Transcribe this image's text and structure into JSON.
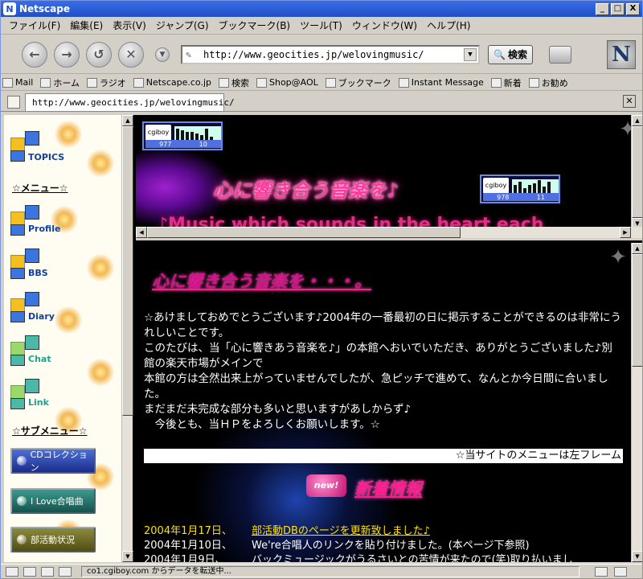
{
  "window": {
    "title": "Netscape",
    "buttons": [
      "_",
      "□",
      "X"
    ]
  },
  "menu": [
    "ファイル(F)",
    "編集(E)",
    "表示(V)",
    "ジャンプ(G)",
    "ブックマーク(B)",
    "ツール(T)",
    "ウィンドウ(W)",
    "ヘルプ(H)"
  ],
  "nav": {
    "url": "http://www.geocities.jp/welovingmusic/",
    "search_label": "検索",
    "logo_letter": "N"
  },
  "personal_toolbar": [
    "Mail",
    "ホーム",
    "ラジオ",
    "Netscape.co.jp",
    "検索",
    "Shop@AOL",
    "ブックマーク",
    "Instant Message",
    "新着",
    "お勧め"
  ],
  "tab": {
    "url": "http://www.geocities.jp/welovingmusic/"
  },
  "left_frame": {
    "topics": "TOPICS",
    "menu_heading": "☆メニュー☆",
    "items": [
      "Profile",
      "BBS",
      "Diary",
      "Chat",
      "Link"
    ],
    "sub_heading": "☆サブメニュー☆",
    "sub_buttons": [
      "CDコレクション",
      "I Love合唱曲",
      "部活動状況"
    ]
  },
  "top_frame": {
    "counter1": {
      "logo": "cgiboy",
      "left": "977",
      "right": "10"
    },
    "counter2": {
      "logo": "cgiboy",
      "left": "978",
      "right": "11"
    },
    "title": "心に響き合う音楽を♪",
    "marquee": "♪Music which sounds in the heart each"
  },
  "main_frame": {
    "heading": "心に響き合う音楽を・・・。",
    "paragraphs": [
      "☆あけましておめでとうございます♪2004年の一番最初の日に掲示することができるのは非常にうれしいことです。",
      "このたびは、当「心に響きあう音楽を♪」の本館へおいでいただき、ありがとうございました♪別館の楽天市場がメインで",
      "本館の方は全然出来上がっていませんでしたが、急ピッチで進めて、なんとか今日間に合いました。",
      "まだまだ未完成な部分も多いと思いますがあしからず♪",
      "　今後とも、当ＨＰをよろしくお願いします。☆"
    ],
    "notice": "☆当サイトのメニューは左フレーム",
    "news_badge": "new!",
    "news_title": "新着情報",
    "news": [
      {
        "date": "2004年1月17日、",
        "text": "部活動DBのページを更新致しました♪",
        "highlight": true
      },
      {
        "date": "2004年1月10日、",
        "text": "We're合唱人のリンクを貼り付けました。(本ページ下参照)",
        "highlight": false
      },
      {
        "date": "2004年1月9日、",
        "text": "バックミュージックがうるさいとの苦情が来たので(笑)取り払いまし",
        "highlight": false
      }
    ]
  },
  "status": {
    "message": "co1.cgiboy.com からデータを転送中..."
  }
}
